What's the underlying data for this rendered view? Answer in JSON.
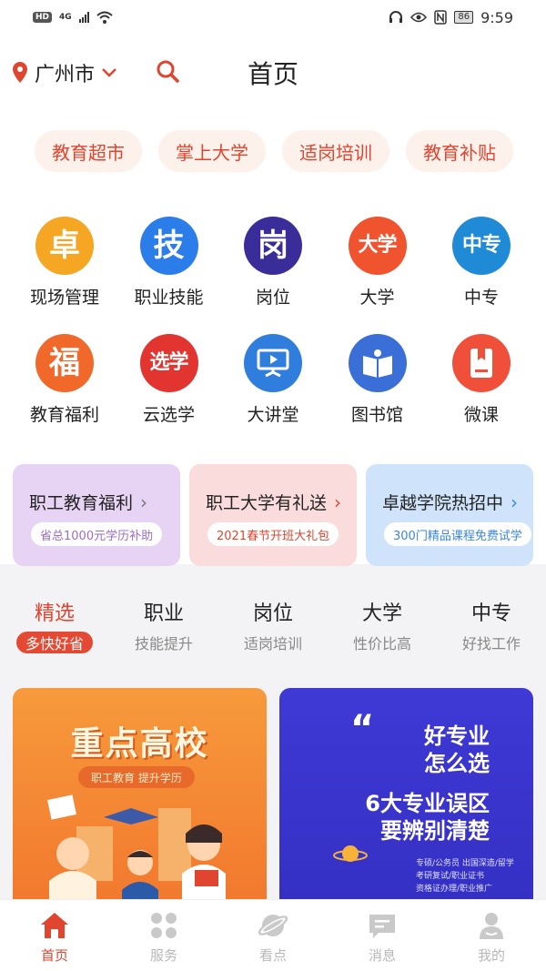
{
  "status_bar": {
    "hd": "HD",
    "signal_type": "4G",
    "battery": "86",
    "time": "9:59"
  },
  "header": {
    "city": "广州市",
    "title": "首页"
  },
  "pills": [
    {
      "label": "教育超市"
    },
    {
      "label": "掌上大学"
    },
    {
      "label": "适岗培训"
    },
    {
      "label": "教育补贴"
    }
  ],
  "grid": {
    "row1": [
      {
        "label": "现场管理",
        "glyph": "卓",
        "color": "#f5a623"
      },
      {
        "label": "职业技能",
        "glyph": "技",
        "color": "#2b7de9"
      },
      {
        "label": "岗位",
        "glyph": "岗",
        "color": "#3a2d9a"
      },
      {
        "label": "大学",
        "glyph": "大学",
        "color": "#f0542f"
      },
      {
        "label": "中专",
        "glyph": "中专",
        "color": "#1f8ad6"
      }
    ],
    "row2": [
      {
        "label": "教育福利",
        "glyph": "福",
        "color": "#f0682a"
      },
      {
        "label": "云选学",
        "glyph": "选学",
        "color": "#e3352f"
      },
      {
        "label": "大讲堂",
        "glyph": "",
        "color": "#2f7ede"
      },
      {
        "label": "图书馆",
        "glyph": "",
        "color": "#3b6fd8"
      },
      {
        "label": "微课",
        "glyph": "",
        "color": "#f0503a"
      }
    ]
  },
  "promos": [
    {
      "title": "职工教育福利",
      "sub": "省总1000元学历补助",
      "bg": "#e7d3f3",
      "sub_color": "#9b6cc6",
      "chev_color": "#777777"
    },
    {
      "title": "职工大学有礼送",
      "sub": "2021春节开班大礼包",
      "bg": "#fbdcdc",
      "sub_color": "#e0452f",
      "chev_color": "#e0452f"
    },
    {
      "title": "卓越学院热招中",
      "sub": "300门精品课程免费试学",
      "bg": "#cfe4fb",
      "sub_color": "#3a86e0",
      "chev_color": "#3a86e0"
    }
  ],
  "tabs": [
    {
      "name": "精选",
      "sub": "多快好省"
    },
    {
      "name": "职业",
      "sub": "技能提升"
    },
    {
      "name": "岗位",
      "sub": "适岗培训"
    },
    {
      "name": "大学",
      "sub": "性价比高"
    },
    {
      "name": "中专",
      "sub": "好找工作"
    }
  ],
  "cards": {
    "a_title": "重点高校",
    "a_sub": "职工教育  提升学历",
    "b_line1": "好专业",
    "b_line2": "怎么选",
    "b_line3": "6大专业误区",
    "b_line4": "要辨别清楚",
    "b_small1": "专硕/公务员 出国深造/留学",
    "b_small2": "考研复试/职业证书",
    "b_small3": "资格证办理/职业推广"
  },
  "bottom_nav": [
    {
      "label": "首页"
    },
    {
      "label": "服务"
    },
    {
      "label": "看点"
    },
    {
      "label": "消息"
    },
    {
      "label": "我的"
    }
  ],
  "colors": {
    "accent": "#e0452f",
    "inactive": "#b8b8b8"
  }
}
